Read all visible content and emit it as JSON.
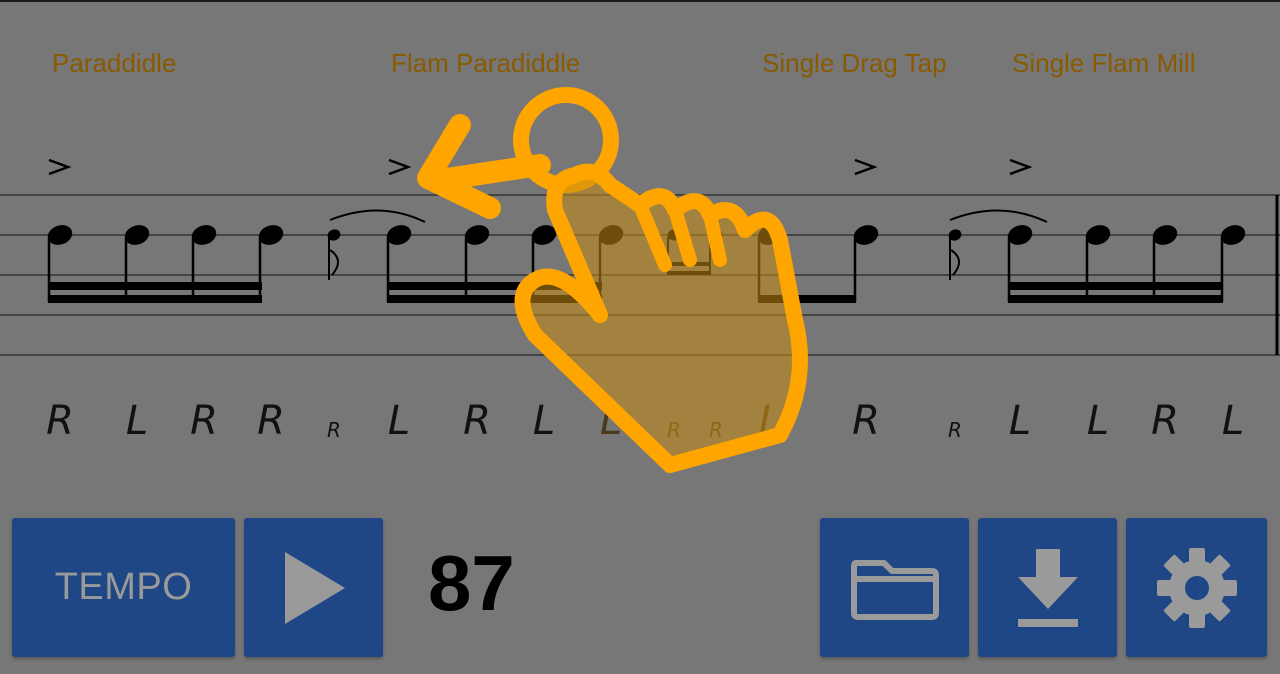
{
  "rudiments": [
    {
      "title": "Paraddidle"
    },
    {
      "title": "Flam Paradiddle"
    },
    {
      "title": "Single Drag Tap"
    },
    {
      "title": "Single Flam Mill"
    }
  ],
  "sticking": [
    {
      "text": "R"
    },
    {
      "text": "L"
    },
    {
      "text": "R"
    },
    {
      "text": "R"
    },
    {
      "text": "R"
    },
    {
      "text": "L"
    },
    {
      "text": "R"
    },
    {
      "text": "L"
    },
    {
      "text": "L"
    },
    {
      "text": "R"
    },
    {
      "text": "R"
    },
    {
      "text": "L"
    },
    {
      "text": "R"
    },
    {
      "text": "R"
    },
    {
      "text": "L"
    },
    {
      "text": "L"
    },
    {
      "text": "R"
    },
    {
      "text": "L"
    }
  ],
  "controls": {
    "tempo_label": "TEMPO",
    "tempo_value": "87",
    "play_icon": "play-icon",
    "open_icon": "folder-icon",
    "download_icon": "download-icon",
    "settings_icon": "gear-icon"
  },
  "overlay": {
    "gesture_icon": "swipe-left-hand-icon",
    "accent_color": "#FFA500"
  },
  "colors": {
    "background": "#777777",
    "button": "#1F4785",
    "title_text": "#8A5A00"
  }
}
